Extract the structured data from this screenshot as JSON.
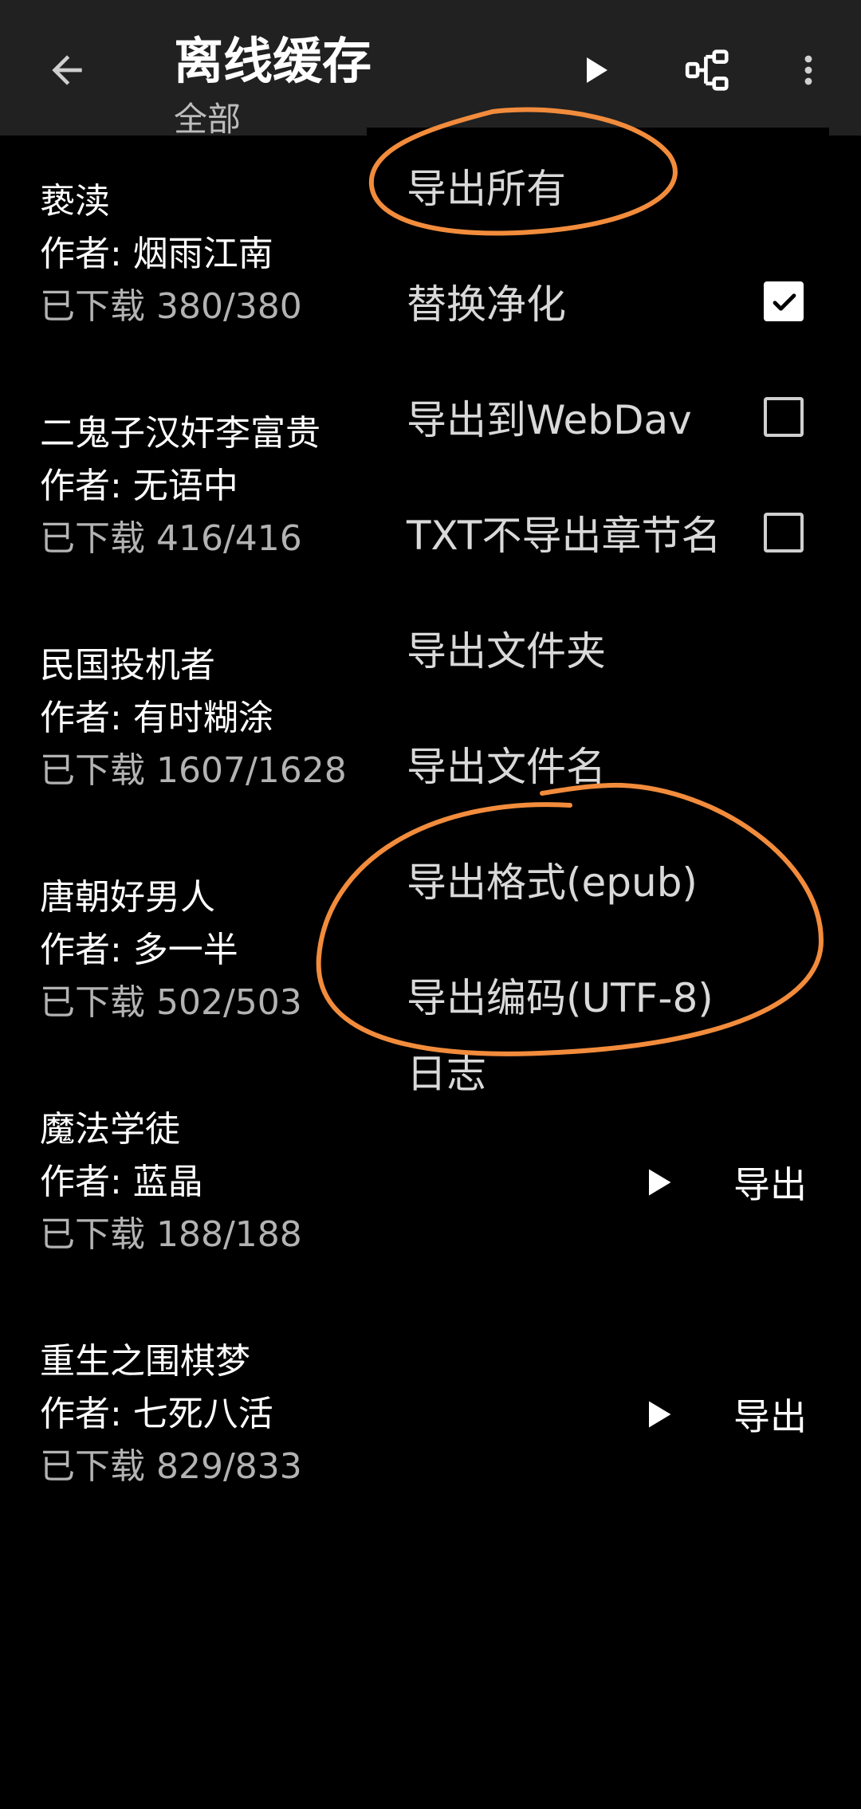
{
  "appbar": {
    "title": "离线缓存",
    "subtitle": "全部",
    "back_icon": "arrow-back-icon",
    "actions": [
      "play-icon",
      "tree-structure-icon",
      "more-vert-icon"
    ]
  },
  "books": [
    {
      "title": "亵渎",
      "author": "作者: 烟雨江南",
      "progress": "已下载 380/380"
    },
    {
      "title": "二鬼子汉奸李富贵",
      "author": "作者: 无语中",
      "progress": "已下载 416/416"
    },
    {
      "title": "民国投机者",
      "author": "作者: 有时糊涂",
      "progress": "已下载 1607/1628"
    },
    {
      "title": "唐朝好男人",
      "author": "作者: 多一半",
      "progress": "已下载 502/503"
    },
    {
      "title": "魔法学徒",
      "author": "作者: 蓝晶",
      "progress": "已下载 188/188",
      "export_label": "导出"
    },
    {
      "title": "重生之围棋梦",
      "author": "作者: 七死八活",
      "progress": "已下载 829/833",
      "export_label": "导出"
    }
  ],
  "menu": {
    "items": [
      {
        "label": "导出所有"
      },
      {
        "label": "替换净化",
        "checked": true
      },
      {
        "label": "导出到WebDav",
        "checked": false
      },
      {
        "label": "TXT不导出章节名",
        "checked": false
      },
      {
        "label": "导出文件夹"
      },
      {
        "label": "导出文件名"
      },
      {
        "label": "导出格式(epub)"
      },
      {
        "label": "导出编码(UTF-8)"
      },
      {
        "label": "日志"
      }
    ]
  },
  "colors": {
    "background": "#000000",
    "appbar": "#212121",
    "annotation": "#f28c3c",
    "secondary_text": "#b3b3b3"
  }
}
